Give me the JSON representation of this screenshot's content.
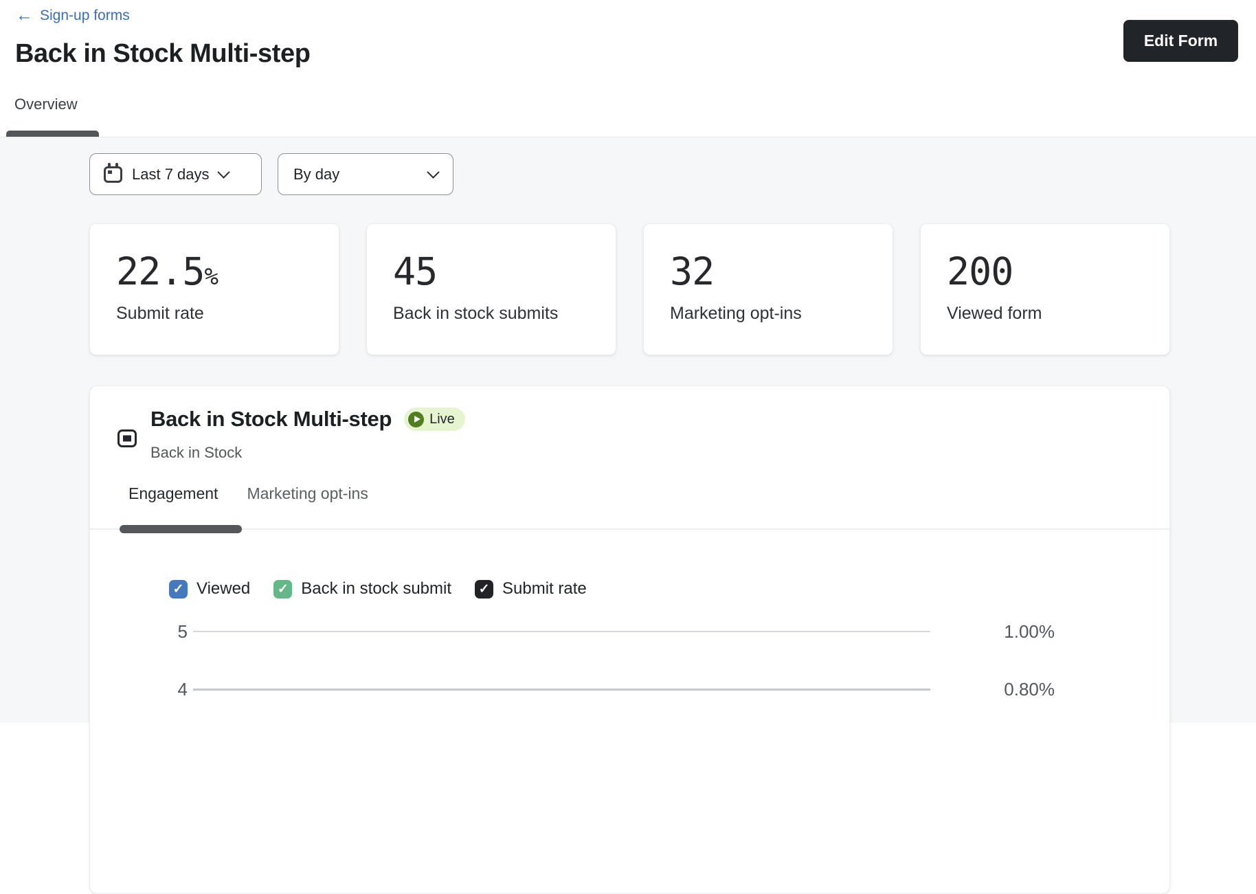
{
  "page": {
    "back_link": "Sign-up forms",
    "title": "Back in Stock Multi-step",
    "active_tab": "Overview",
    "edit_button": "Edit Form"
  },
  "filters": {
    "date_range": "Last 7 days",
    "interval": "By day"
  },
  "metrics": [
    {
      "value": "22.5",
      "unit": "%",
      "label": "Submit rate"
    },
    {
      "value": "45",
      "unit": "",
      "label": "Back in stock submits"
    },
    {
      "value": "32",
      "unit": "",
      "label": "Marketing opt-ins"
    },
    {
      "value": "200",
      "unit": "",
      "label": "Viewed form"
    }
  ],
  "form_card": {
    "title": "Back in Stock Multi-step",
    "status": "Live",
    "subtitle": "Back in Stock",
    "tabs": [
      {
        "label": "Engagement",
        "active": true
      },
      {
        "label": "Marketing opt-ins",
        "active": false
      }
    ],
    "legend": [
      {
        "label": "Viewed",
        "checked": true,
        "color": "#4678bd",
        "check": "✓"
      },
      {
        "label": "Back in stock submit",
        "checked": true,
        "color": "#64b888",
        "check": "✓"
      },
      {
        "label": "Submit rate",
        "checked": true,
        "color": "#212327",
        "check": "✓"
      }
    ]
  },
  "chart_data": {
    "type": "line",
    "series": [
      {
        "name": "Viewed",
        "color": "#4678bd"
      },
      {
        "name": "Back in stock submit",
        "color": "#64b888"
      },
      {
        "name": "Submit rate",
        "color": "#212327"
      }
    ],
    "left_axis_visible_ticks": [
      "5",
      "4"
    ],
    "right_axis_visible_ticks": [
      "1.00%",
      "0.80%"
    ],
    "grid": true
  },
  "colors": {
    "accent_blue": "#3a6dbf",
    "live_badge_bg": "#e7f4d0",
    "live_badge_dot": "#517d21",
    "content_bg": "#f6f7f8",
    "edit_button_bg": "#212428"
  }
}
